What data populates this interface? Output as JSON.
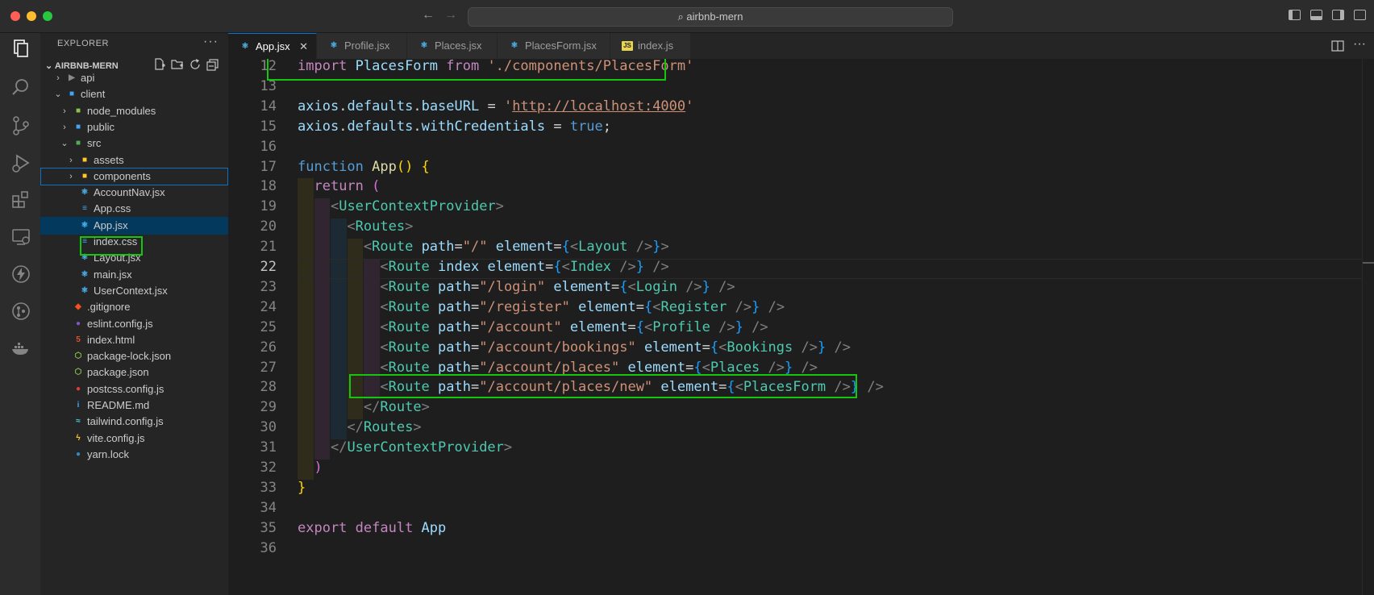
{
  "window": {
    "command_center": "airbnb-mern"
  },
  "activity_bar": [
    "explorer-icon",
    "search-icon",
    "source-control-icon",
    "run-debug-icon",
    "extensions-icon",
    "remote-explorer-icon",
    "lightning-icon",
    "git-graph-icon",
    "docker-icon"
  ],
  "sidebar": {
    "header": "EXPLORER",
    "more": "···",
    "section": "AIRBNB-MERN",
    "tree": [
      {
        "label": "api",
        "kind": "folder",
        "chev": "›",
        "depth": 0,
        "icon": "folder-icon"
      },
      {
        "label": "client",
        "kind": "folder",
        "chev": "⌄",
        "depth": 0,
        "icon": "folder-client-icon"
      },
      {
        "label": "node_modules",
        "kind": "folder",
        "chev": "›",
        "depth": 1,
        "icon": "folder-node-icon"
      },
      {
        "label": "public",
        "kind": "folder",
        "chev": "›",
        "depth": 1,
        "icon": "folder-public-icon"
      },
      {
        "label": "src",
        "kind": "folder",
        "chev": "⌄",
        "depth": 1,
        "icon": "folder-src-icon"
      },
      {
        "label": "assets",
        "kind": "folder",
        "chev": "›",
        "depth": 2,
        "icon": "folder-assets-icon"
      },
      {
        "label": "components",
        "kind": "folder",
        "chev": "›",
        "depth": 2,
        "icon": "folder-components-icon"
      },
      {
        "label": "AccountNav.jsx",
        "kind": "file",
        "depth": 2,
        "icon": "react-icon"
      },
      {
        "label": "App.css",
        "kind": "file",
        "depth": 2,
        "icon": "css-icon"
      },
      {
        "label": "App.jsx",
        "kind": "file",
        "depth": 2,
        "icon": "react-icon"
      },
      {
        "label": "index.css",
        "kind": "file",
        "depth": 2,
        "icon": "css-icon"
      },
      {
        "label": "Layout.jsx",
        "kind": "file",
        "depth": 2,
        "icon": "react-icon"
      },
      {
        "label": "main.jsx",
        "kind": "file",
        "depth": 2,
        "icon": "react-icon"
      },
      {
        "label": "UserContext.jsx",
        "kind": "file",
        "depth": 2,
        "icon": "react-icon"
      },
      {
        "label": ".gitignore",
        "kind": "file",
        "depth": 1,
        "icon": "git-icon"
      },
      {
        "label": "eslint.config.js",
        "kind": "file",
        "depth": 1,
        "icon": "eslint-icon"
      },
      {
        "label": "index.html",
        "kind": "file",
        "depth": 1,
        "icon": "html-icon"
      },
      {
        "label": "package-lock.json",
        "kind": "file",
        "depth": 1,
        "icon": "nodejs-icon"
      },
      {
        "label": "package.json",
        "kind": "file",
        "depth": 1,
        "icon": "nodejs-icon"
      },
      {
        "label": "postcss.config.js",
        "kind": "file",
        "depth": 1,
        "icon": "postcss-icon"
      },
      {
        "label": "README.md",
        "kind": "file",
        "depth": 1,
        "icon": "info-icon"
      },
      {
        "label": "tailwind.config.js",
        "kind": "file",
        "depth": 1,
        "icon": "tailwind-icon"
      },
      {
        "label": "vite.config.js",
        "kind": "file",
        "depth": 1,
        "icon": "vite-icon"
      },
      {
        "label": "yarn.lock",
        "kind": "file",
        "depth": 1,
        "icon": "yarn-icon"
      }
    ]
  },
  "tabs": [
    {
      "label": "App.jsx",
      "icon": "react-icon",
      "close": "✕"
    },
    {
      "label": "Profile.jsx",
      "icon": "react-icon"
    },
    {
      "label": "Places.jsx",
      "icon": "react-icon"
    },
    {
      "label": "PlacesForm.jsx",
      "icon": "react-icon"
    },
    {
      "label": "index.js",
      "icon": "js-icon"
    }
  ],
  "editor": {
    "current_line": 22,
    "lines": [
      {
        "n": 12,
        "t": [
          [
            "kw",
            "import "
          ],
          [
            "vr",
            "PlacesForm "
          ],
          [
            "kw",
            "from "
          ],
          [
            "str",
            "'./components/PlacesForm'"
          ]
        ]
      },
      {
        "n": 13,
        "t": []
      },
      {
        "n": 14,
        "t": [
          [
            "vr",
            "axios"
          ],
          [
            "",
            "."
          ],
          [
            "vr",
            "defaults"
          ],
          [
            "",
            "."
          ],
          [
            "vr",
            "baseURL"
          ],
          [
            "",
            " = "
          ],
          [
            "str",
            "'"
          ],
          [
            "url",
            "http://localhost:4000"
          ],
          [
            "str",
            "'"
          ]
        ]
      },
      {
        "n": 15,
        "t": [
          [
            "vr",
            "axios"
          ],
          [
            "",
            "."
          ],
          [
            "vr",
            "defaults"
          ],
          [
            "",
            "."
          ],
          [
            "vr",
            "withCredentials"
          ],
          [
            "",
            " = "
          ],
          [
            "kb",
            "true"
          ],
          [
            "",
            ";"
          ]
        ]
      },
      {
        "n": 16,
        "t": []
      },
      {
        "n": 17,
        "t": [
          [
            "kb",
            "function "
          ],
          [
            "fn",
            "App"
          ],
          [
            "br1",
            "() {"
          ]
        ]
      },
      {
        "n": 18,
        "t": [
          [
            "",
            "  "
          ],
          [
            "kw",
            "return "
          ],
          [
            "br2",
            "("
          ]
        ]
      },
      {
        "n": 19,
        "t": [
          [
            "",
            "    "
          ],
          [
            "pun",
            "<"
          ],
          [
            "tag",
            "UserContextProvider"
          ],
          [
            "pun",
            ">"
          ]
        ]
      },
      {
        "n": 20,
        "t": [
          [
            "",
            "      "
          ],
          [
            "pun",
            "<"
          ],
          [
            "tag",
            "Routes"
          ],
          [
            "pun",
            ">"
          ]
        ]
      },
      {
        "n": 21,
        "t": [
          [
            "",
            "        "
          ],
          [
            "pun",
            "<"
          ],
          [
            "tag",
            "Route "
          ],
          [
            "vr",
            "path"
          ],
          [
            "",
            "="
          ],
          [
            "str",
            "\"/\" "
          ],
          [
            "vr",
            "element"
          ],
          [
            "",
            "="
          ],
          [
            "br3",
            "{"
          ],
          [
            "pun",
            "<"
          ],
          [
            "tag",
            "Layout "
          ],
          [
            "pun",
            "/>"
          ],
          [
            "br3",
            "}"
          ],
          [
            "pun",
            ">"
          ]
        ]
      },
      {
        "n": 22,
        "t": [
          [
            "",
            "          "
          ],
          [
            "pun",
            "<"
          ],
          [
            "tag",
            "Route "
          ],
          [
            "vr",
            "index "
          ],
          [
            "vr",
            "element"
          ],
          [
            "",
            "="
          ],
          [
            "br3",
            "{"
          ],
          [
            "pun",
            "<"
          ],
          [
            "tag",
            "Index "
          ],
          [
            "pun",
            "/>"
          ],
          [
            "br3",
            "}"
          ],
          [
            "",
            " "
          ],
          [
            "pun",
            "/>"
          ]
        ]
      },
      {
        "n": 23,
        "t": [
          [
            "",
            "          "
          ],
          [
            "pun",
            "<"
          ],
          [
            "tag",
            "Route "
          ],
          [
            "vr",
            "path"
          ],
          [
            "",
            "="
          ],
          [
            "str",
            "\"/login\" "
          ],
          [
            "vr",
            "element"
          ],
          [
            "",
            "="
          ],
          [
            "br3",
            "{"
          ],
          [
            "pun",
            "<"
          ],
          [
            "tag",
            "Login "
          ],
          [
            "pun",
            "/>"
          ],
          [
            "br3",
            "}"
          ],
          [
            "",
            " "
          ],
          [
            "pun",
            "/>"
          ]
        ]
      },
      {
        "n": 24,
        "t": [
          [
            "",
            "          "
          ],
          [
            "pun",
            "<"
          ],
          [
            "tag",
            "Route "
          ],
          [
            "vr",
            "path"
          ],
          [
            "",
            "="
          ],
          [
            "str",
            "\"/register\" "
          ],
          [
            "vr",
            "element"
          ],
          [
            "",
            "="
          ],
          [
            "br3",
            "{"
          ],
          [
            "pun",
            "<"
          ],
          [
            "tag",
            "Register "
          ],
          [
            "pun",
            "/>"
          ],
          [
            "br3",
            "}"
          ],
          [
            "",
            " "
          ],
          [
            "pun",
            "/>"
          ]
        ]
      },
      {
        "n": 25,
        "t": [
          [
            "",
            "          "
          ],
          [
            "pun",
            "<"
          ],
          [
            "tag",
            "Route "
          ],
          [
            "vr",
            "path"
          ],
          [
            "",
            "="
          ],
          [
            "str",
            "\"/account\" "
          ],
          [
            "vr",
            "element"
          ],
          [
            "",
            "="
          ],
          [
            "br3",
            "{"
          ],
          [
            "pun",
            "<"
          ],
          [
            "tag",
            "Profile "
          ],
          [
            "pun",
            "/>"
          ],
          [
            "br3",
            "}"
          ],
          [
            "",
            " "
          ],
          [
            "pun",
            "/>"
          ]
        ]
      },
      {
        "n": 26,
        "t": [
          [
            "",
            "          "
          ],
          [
            "pun",
            "<"
          ],
          [
            "tag",
            "Route "
          ],
          [
            "vr",
            "path"
          ],
          [
            "",
            "="
          ],
          [
            "str",
            "\"/account/bookings\" "
          ],
          [
            "vr",
            "element"
          ],
          [
            "",
            "="
          ],
          [
            "br3",
            "{"
          ],
          [
            "pun",
            "<"
          ],
          [
            "tag",
            "Bookings "
          ],
          [
            "pun",
            "/>"
          ],
          [
            "br3",
            "}"
          ],
          [
            "",
            " "
          ],
          [
            "pun",
            "/>"
          ]
        ]
      },
      {
        "n": 27,
        "t": [
          [
            "",
            "          "
          ],
          [
            "pun",
            "<"
          ],
          [
            "tag",
            "Route "
          ],
          [
            "vr",
            "path"
          ],
          [
            "",
            "="
          ],
          [
            "str",
            "\"/account/places\" "
          ],
          [
            "vr",
            "element"
          ],
          [
            "",
            "="
          ],
          [
            "br3",
            "{"
          ],
          [
            "pun",
            "<"
          ],
          [
            "tag",
            "Places "
          ],
          [
            "pun",
            "/>"
          ],
          [
            "br3",
            "}"
          ],
          [
            "",
            " "
          ],
          [
            "pun",
            "/>"
          ]
        ]
      },
      {
        "n": 28,
        "t": [
          [
            "",
            "          "
          ],
          [
            "pun",
            "<"
          ],
          [
            "tag",
            "Route "
          ],
          [
            "vr",
            "path"
          ],
          [
            "",
            "="
          ],
          [
            "str",
            "\"/account/places/new\" "
          ],
          [
            "vr",
            "element"
          ],
          [
            "",
            "="
          ],
          [
            "br3",
            "{"
          ],
          [
            "pun",
            "<"
          ],
          [
            "tag",
            "PlacesForm "
          ],
          [
            "pun",
            "/>"
          ],
          [
            "br3",
            "}"
          ],
          [
            "",
            " "
          ],
          [
            "pun",
            "/>"
          ]
        ]
      },
      {
        "n": 29,
        "t": [
          [
            "",
            "        "
          ],
          [
            "pun",
            "</"
          ],
          [
            "tag",
            "Route"
          ],
          [
            "pun",
            ">"
          ]
        ]
      },
      {
        "n": 30,
        "t": [
          [
            "",
            "      "
          ],
          [
            "pun",
            "</"
          ],
          [
            "tag",
            "Routes"
          ],
          [
            "pun",
            ">"
          ]
        ]
      },
      {
        "n": 31,
        "t": [
          [
            "",
            "    "
          ],
          [
            "pun",
            "</"
          ],
          [
            "tag",
            "UserContextProvider"
          ],
          [
            "pun",
            ">"
          ]
        ]
      },
      {
        "n": 32,
        "t": [
          [
            "",
            "  "
          ],
          [
            "br2",
            ")"
          ]
        ]
      },
      {
        "n": 33,
        "t": [
          [
            "br1",
            "}"
          ]
        ]
      },
      {
        "n": 34,
        "t": []
      },
      {
        "n": 35,
        "t": [
          [
            "kw",
            "export "
          ],
          [
            "kw",
            "default "
          ],
          [
            "vr",
            "App"
          ]
        ]
      },
      {
        "n": 36,
        "t": []
      }
    ]
  },
  "colors": {
    "highlight_box": "#16c60c",
    "accent": "#0078d4"
  }
}
